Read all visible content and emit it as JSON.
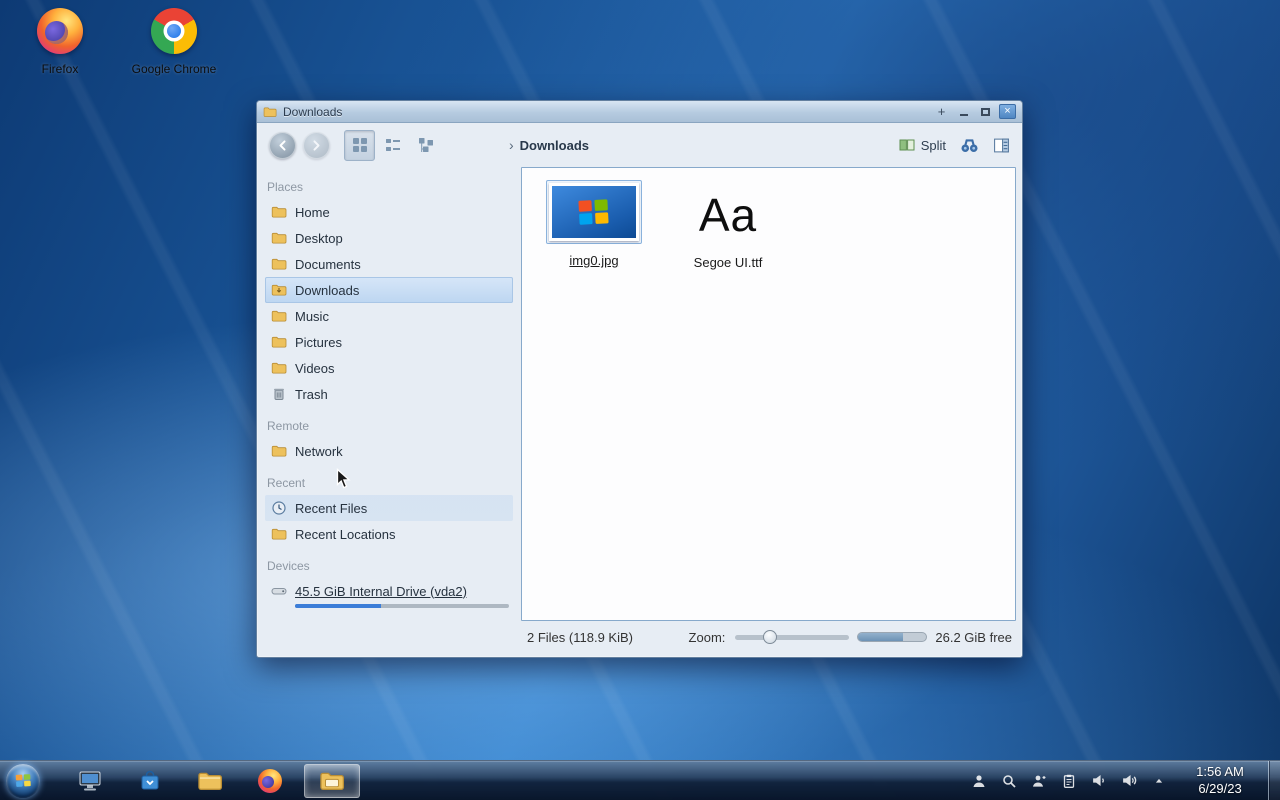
{
  "desktop": {
    "icons": [
      {
        "label": "Firefox"
      },
      {
        "label": "Google Chrome"
      }
    ]
  },
  "window": {
    "title": "Downloads",
    "controls": {
      "pin": "+",
      "close": "×"
    },
    "toolbar": {
      "breadcrumb_chevron": "›",
      "breadcrumb": "Downloads",
      "split_label": "Split"
    },
    "sidebar": {
      "sections": [
        "Places",
        "Remote",
        "Recent",
        "Devices"
      ],
      "places": [
        "Home",
        "Desktop",
        "Documents",
        "Downloads",
        "Music",
        "Pictures",
        "Videos",
        "Trash"
      ],
      "remote": [
        "Network"
      ],
      "recent": [
        "Recent Files",
        "Recent Locations"
      ],
      "devices": [
        "45.5 GiB Internal Drive (vda2)"
      ],
      "selected_item": "Downloads"
    },
    "files": [
      {
        "name": "img0.jpg",
        "type": "image"
      },
      {
        "name": "Segoe UI.ttf",
        "type": "font",
        "preview": "Aa"
      }
    ],
    "statusbar": {
      "files_summary": "2 Files (118.9 KiB)",
      "zoom_label": "Zoom:",
      "free_space": "26.2 GiB free",
      "zoom_percent": 28,
      "disk_used_percent": 65
    },
    "device_bar_percent": 40
  },
  "taskbar": {
    "app_icons": [
      "display-icon",
      "software-bag-icon",
      "folder-icon",
      "firefox-icon",
      "file-manager-icon"
    ],
    "tray_icons": [
      "user-icon",
      "search-icon",
      "user-icon",
      "clipboard-icon",
      "volume-low-icon",
      "volume-high-icon",
      "caret-up-icon"
    ],
    "clock": {
      "time": "1:56 AM",
      "date": "6/29/23"
    }
  },
  "colors": {
    "selection": "#c8def5",
    "accent": "#3b7dd8",
    "titlebar": "#b6cbe0",
    "taskbar_dark": "#10213a"
  }
}
